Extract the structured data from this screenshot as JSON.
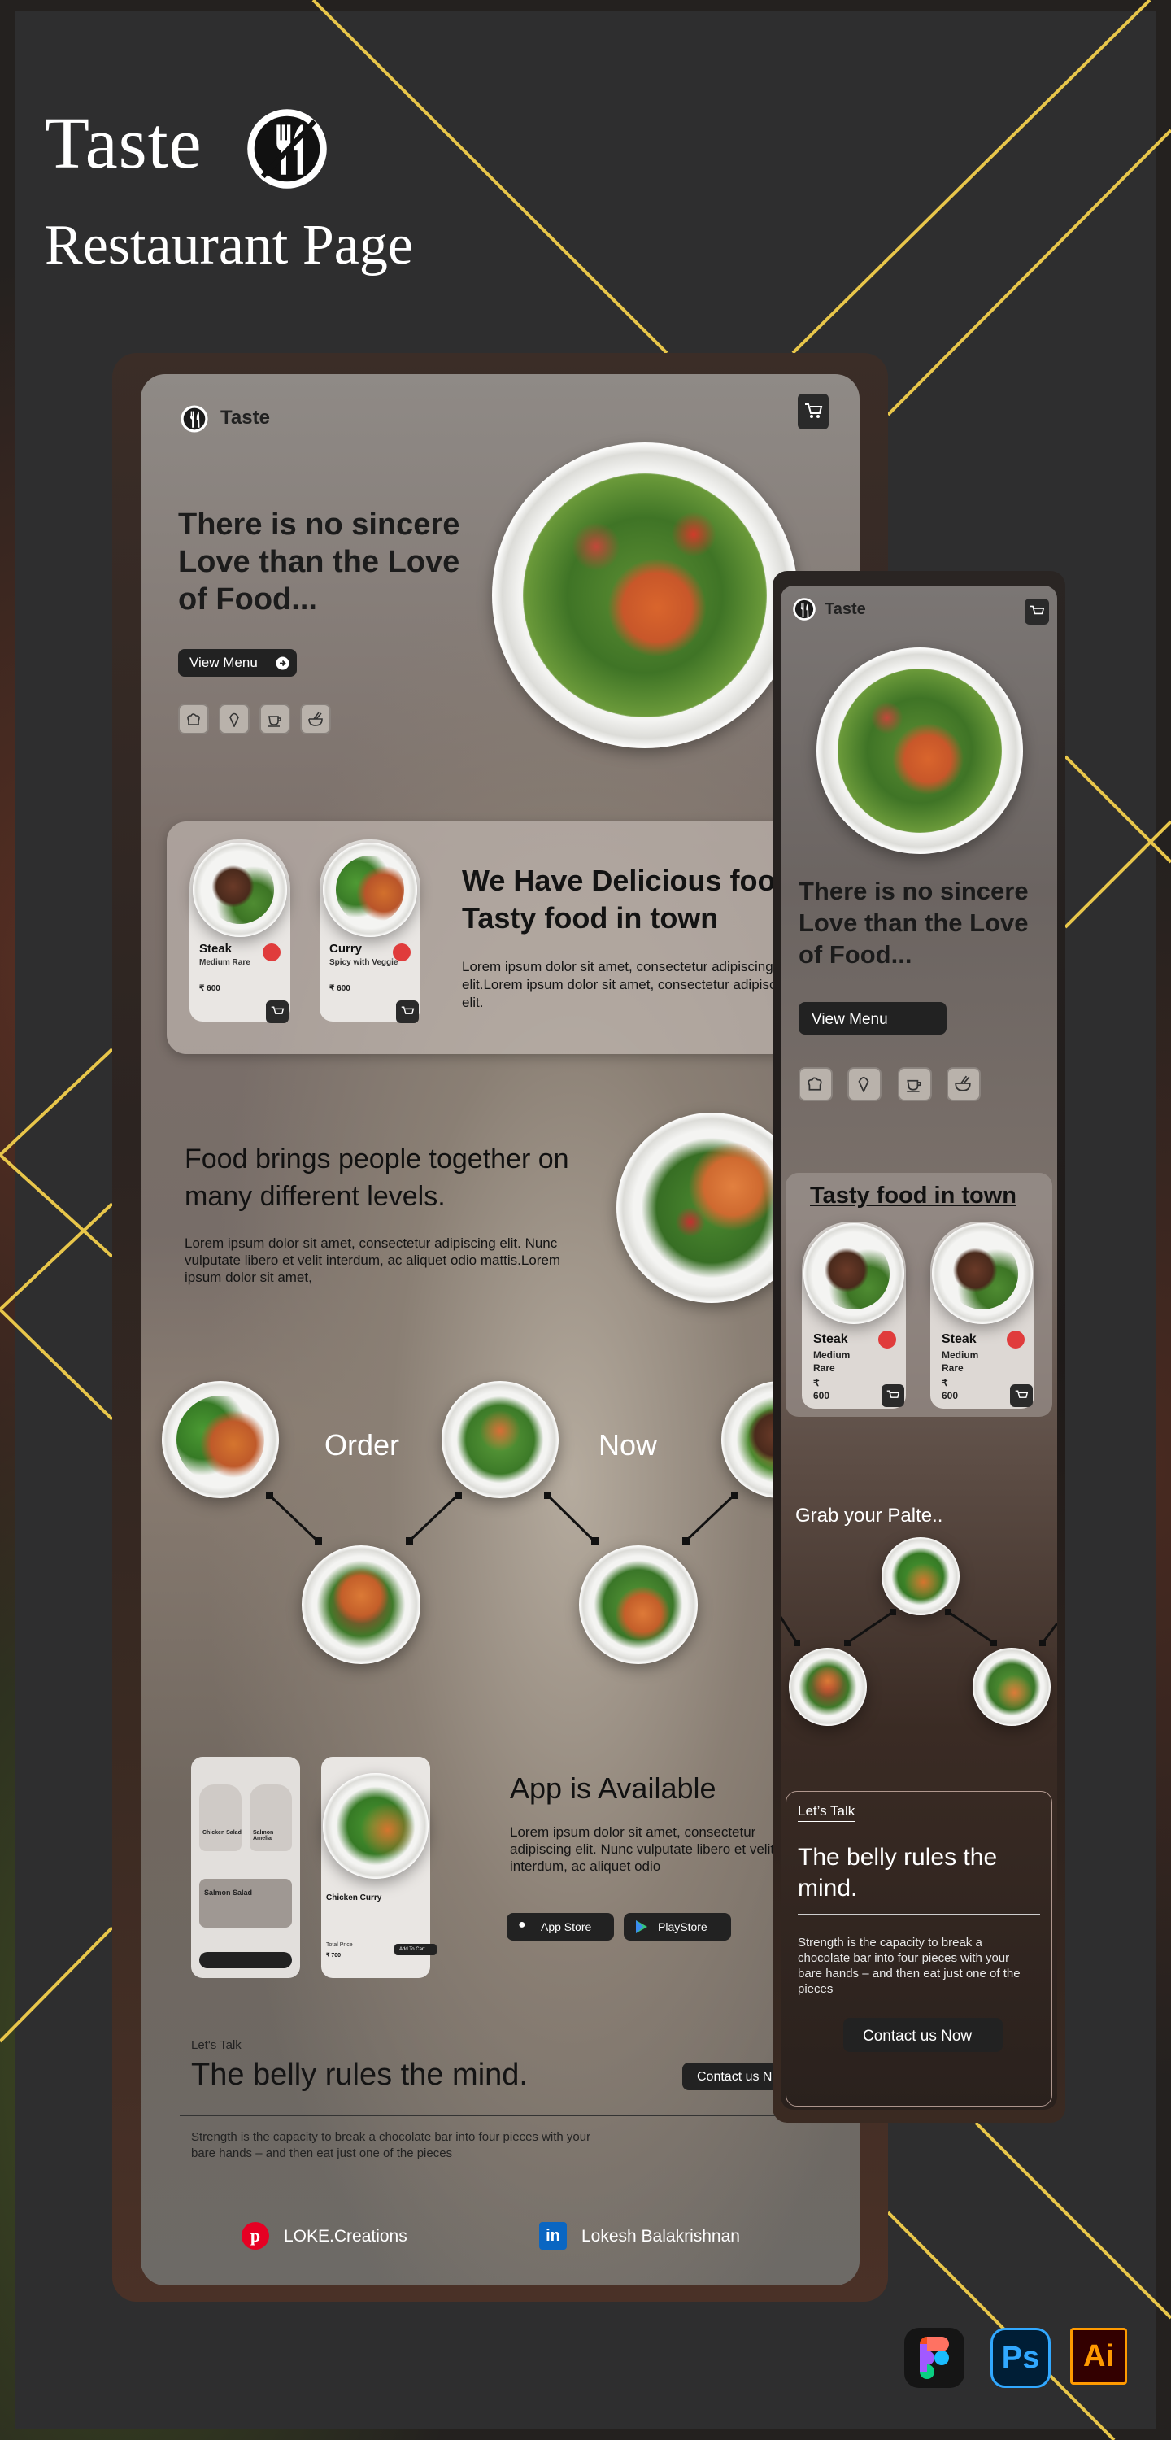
{
  "showcase": {
    "brand": "Taste",
    "subtitle": "Restaurant Page",
    "tool_badges": [
      "figma-icon",
      "Ps",
      "Ai"
    ]
  },
  "desktop": {
    "nav": {
      "brand": "Taste"
    },
    "hero": {
      "title": "There is no sincere Love than the Love of Food...",
      "cta": "View Menu",
      "category_icons": [
        "chef-hat-icon",
        "ice-cream-icon",
        "coffee-cup-icon",
        "noodle-bowl-icon"
      ]
    },
    "featured": {
      "cards": [
        {
          "name": "Steak",
          "note": "Medium Rare",
          "price": "₹ 600"
        },
        {
          "name": "Curry",
          "note": "Spicy with Veggie",
          "price": "₹ 600"
        }
      ],
      "title": "We Have Delicious food Tasty food in town",
      "body": "Lorem ipsum dolor sit amet, consectetur adipiscing elit.Lorem ipsum dolor sit amet, consectetur adipiscing elit."
    },
    "together": {
      "title": "Food brings people together on many different levels.",
      "body": "Lorem ipsum dolor sit amet, consectetur adipiscing elit. Nunc vulputate libero et velit interdum, ac aliquet odio mattis.Lorem ipsum dolor sit amet,"
    },
    "order": {
      "word1": "Order",
      "word2": "Now"
    },
    "app": {
      "title": "App is Available",
      "body": "Lorem ipsum dolor sit amet, consectetur adipiscing elit. Nunc vulputate libero et velit interdum, ac aliquet odio",
      "app_store": "App Store",
      "play_store": "PlayStore",
      "phone1": {
        "items": [
          "Chicken Salad",
          "Salmon Amelia",
          "Salmon Salad"
        ]
      },
      "phone2": {
        "dish": "Chicken Curry",
        "price_label": "Total Price",
        "price": "₹ 700",
        "add": "Add To Cart"
      }
    },
    "contact": {
      "eyebrow": "Let's Talk",
      "title": "The belly rules the mind.",
      "button": "Contact us Now",
      "body": "Strength is the capacity to break a chocolate bar into four pieces with your bare hands – and then eat just one of the pieces"
    },
    "footer": {
      "pinterest": "LOKE.Creations",
      "linkedin": "Lokesh Balakrishnan"
    }
  },
  "mobile": {
    "nav": {
      "brand": "Taste"
    },
    "hero": {
      "title": "There is no sincere Love than the Love of Food...",
      "cta": "View Menu"
    },
    "tasty": {
      "title": "Tasty food in town",
      "cards": [
        {
          "name": "Steak",
          "note": "Medium Rare",
          "price": "₹ 600"
        },
        {
          "name": "Steak",
          "note": "Medium Rare",
          "price": "₹ 600"
        }
      ]
    },
    "grab": "Grab your Palte..",
    "contact": {
      "eyebrow": "Let’s Talk",
      "title": "The belly rules the mind.",
      "body": "Strength is the capacity to break a chocolate bar into four pieces with your bare hands – and then eat just one of the pieces",
      "button": "Contact us Now"
    }
  },
  "colors": {
    "accent_line": "#e8c64a",
    "heart": "#e03c3c",
    "dark": "#222222"
  }
}
